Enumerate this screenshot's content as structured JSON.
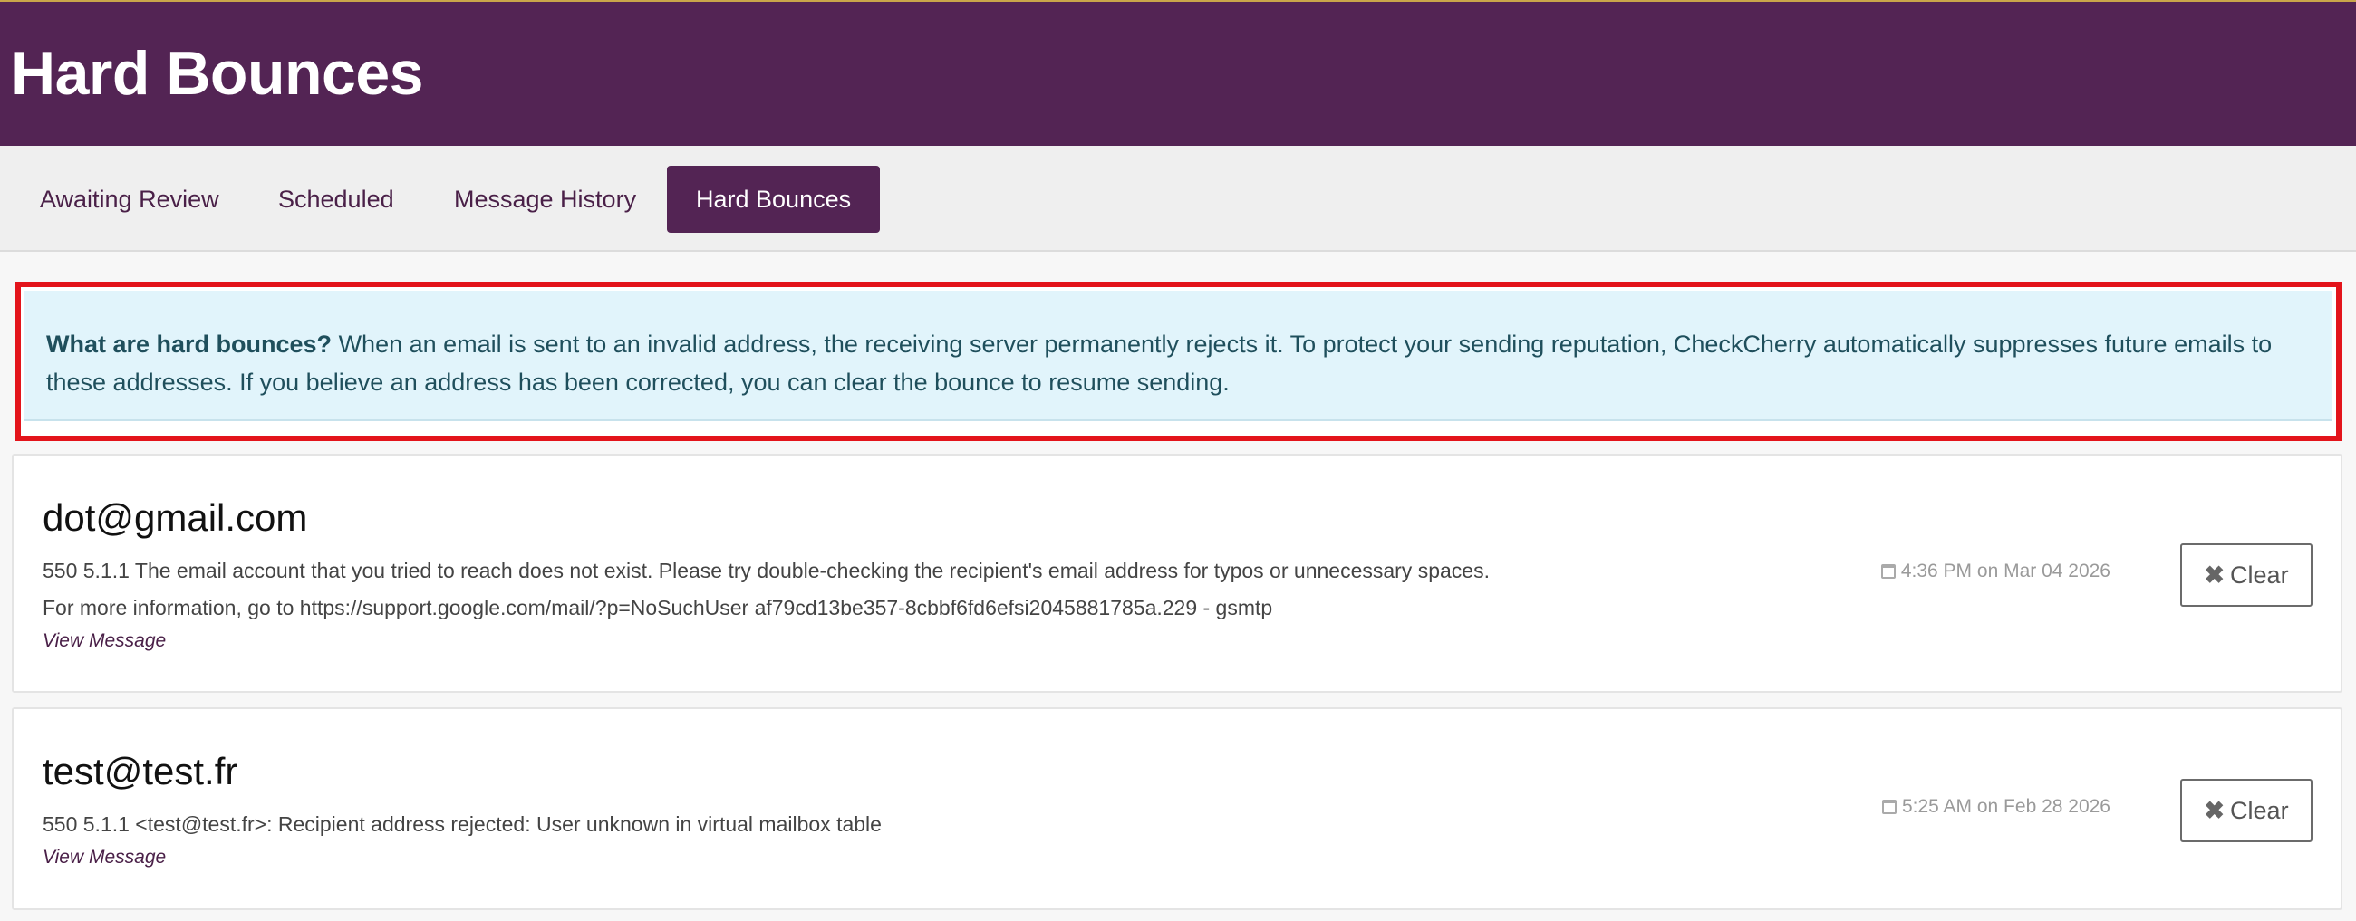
{
  "header": {
    "title": "Hard Bounces"
  },
  "tabs": [
    {
      "label": "Awaiting Review"
    },
    {
      "label": "Scheduled"
    },
    {
      "label": "Message History"
    },
    {
      "label": "Hard Bounces",
      "active": true
    }
  ],
  "info": {
    "title": "What are hard bounces?",
    "text": "When an email is sent to an invalid address, the receiving server permanently rejects it. To protect your sending reputation, CheckCherry automatically suppresses future emails to these addresses. If you believe an address has been corrected, you can clear the bounce to resume sending."
  },
  "bounces": [
    {
      "email": "dot@gmail.com",
      "lines": [
        "550 5.1.1 The email account that you tried to reach does not exist. Please try double-checking the recipient's email address for typos or unnecessary spaces.",
        "For more information, go to https://support.google.com/mail/?p=NoSuchUser af79cd13be357-8cbbf6fd6efsi2045881785a.229 - gsmtp"
      ],
      "link": "View Message",
      "time": "4:36 PM on Mar 04 2026",
      "clear_label": "Clear"
    },
    {
      "email": "test@test.fr",
      "lines": [
        "550 5.1.1 <test@test.fr>: Recipient address rejected: User unknown in virtual mailbox table"
      ],
      "link": "View Message",
      "time": "5:25 AM on Feb 28 2026",
      "clear_label": "Clear"
    }
  ],
  "icons": {
    "time": "calendar-icon",
    "clear": "close-x-icon"
  },
  "colors": {
    "brand": "#532454",
    "info_bg": "#e1f4fb",
    "highlight": "#e3141b"
  }
}
